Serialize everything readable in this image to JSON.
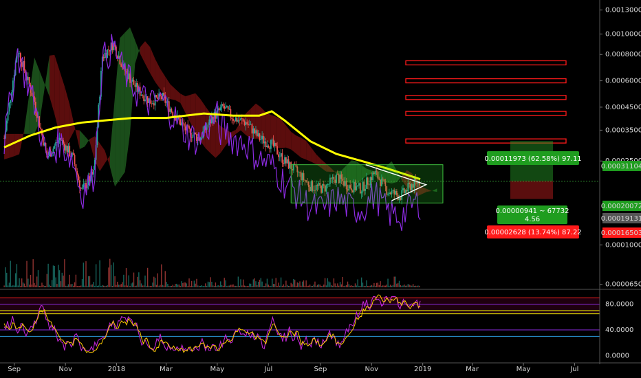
{
  "chart_data": {
    "type": "candlestick",
    "price_axis": {
      "scale": "log",
      "ticks": [
        "0.00130000",
        "0.00100000",
        "0.00080000",
        "0.00060000",
        "0.00045000",
        "0.00035000",
        "0.00025000",
        "0.00010000",
        "0.00006500"
      ],
      "tick_values": [
        0.0013,
        0.001,
        0.0008,
        0.0006,
        0.00045,
        0.00035,
        0.00025,
        0.0001,
        6.5e-05
      ],
      "range": [
        6.2e-05,
        0.00145
      ]
    },
    "time_axis": {
      "labels": [
        "Sep",
        "Nov",
        "2018",
        "Mar",
        "May",
        "Jul",
        "Sep",
        "Nov",
        "2019",
        "Mar",
        "May",
        "Jul"
      ]
    },
    "price_series": [
      [
        "2017-08-20",
        0.00032
      ],
      [
        "2017-09-05",
        0.00085
      ],
      [
        "2017-09-25",
        0.00048
      ],
      [
        "2017-10-10",
        0.00026
      ],
      [
        "2017-10-25",
        0.00032
      ],
      [
        "2017-11-10",
        0.00026
      ],
      [
        "2017-11-20",
        0.00018
      ],
      [
        "2017-12-05",
        0.00022
      ],
      [
        "2017-12-15",
        0.00078
      ],
      [
        "2017-12-28",
        0.0009
      ],
      [
        "2018-01-10",
        0.00068
      ],
      [
        "2018-01-25",
        0.00055
      ],
      [
        "2018-02-10",
        0.00048
      ],
      [
        "2018-02-25",
        0.0005
      ],
      [
        "2018-03-10",
        0.00042
      ],
      [
        "2018-03-25",
        0.00035
      ],
      [
        "2018-04-10",
        0.00032
      ],
      [
        "2018-04-25",
        0.0004
      ],
      [
        "2018-05-08",
        0.00045
      ],
      [
        "2018-05-20",
        0.0004
      ],
      [
        "2018-06-05",
        0.00038
      ],
      [
        "2018-06-20",
        0.00032
      ],
      [
        "2018-07-05",
        0.0003
      ],
      [
        "2018-07-20",
        0.00025
      ],
      [
        "2018-08-05",
        0.00022
      ],
      [
        "2018-08-20",
        0.00019
      ],
      [
        "2018-09-05",
        0.000185
      ],
      [
        "2018-09-20",
        0.00021
      ],
      [
        "2018-10-05",
        0.00019
      ],
      [
        "2018-10-20",
        0.000185
      ],
      [
        "2018-11-05",
        0.00022
      ],
      [
        "2018-11-20",
        0.00018
      ],
      [
        "2018-12-05",
        0.00017
      ],
      [
        "2018-12-20",
        0.000195
      ],
      [
        "2018-12-29",
        0.0002007
      ]
    ],
    "moving_average": [
      [
        "2017-08-20",
        0.00029
      ],
      [
        "2017-09-20",
        0.00033
      ],
      [
        "2017-10-20",
        0.00036
      ],
      [
        "2017-11-20",
        0.00038
      ],
      [
        "2017-12-20",
        0.00039
      ],
      [
        "2018-01-20",
        0.0004
      ],
      [
        "2018-03-01",
        0.0004
      ],
      [
        "2018-04-15",
        0.00042
      ],
      [
        "2018-05-20",
        0.00041
      ],
      [
        "2018-06-20",
        0.00041
      ],
      [
        "2018-07-05",
        0.00043
      ],
      [
        "2018-07-20",
        0.00039
      ],
      [
        "2018-08-20",
        0.00031
      ],
      [
        "2018-09-20",
        0.00027
      ],
      [
        "2018-10-20",
        0.00025
      ],
      [
        "2018-11-20",
        0.00023
      ],
      [
        "2018-12-29",
        0.000205
      ]
    ],
    "resistance_levels": [
      0.00073,
      0.0006,
      0.0005,
      0.00042,
      0.00031104
    ],
    "labels": {
      "target": "0.00011973 (62.58%) 97.11",
      "target_level": "0.00031104",
      "current": "0.00020072",
      "position_line1": "0.00000941 ~ 67732",
      "position_line2": "4.56",
      "entry_level": "0.00019131",
      "stop": "0.00002628 (13.74%) 87.22",
      "stop_level": "0.00016503"
    },
    "oscillator": {
      "ticks": [
        "80.0000",
        "40.0000",
        "0.0000"
      ],
      "tick_values": [
        80,
        40,
        0
      ],
      "levels": [
        90,
        80,
        70,
        65,
        40,
        30
      ]
    }
  },
  "colors": {
    "background": "#000000",
    "candle_up": "#26a69a",
    "candle_down": "#ef5350",
    "moving_average": "#ffff00",
    "secondary_line": "#8c2be2",
    "cloud_bear": "#6b0f0f",
    "cloud_bull": "#1f5a1f",
    "resistance": "#ff1a1a",
    "target_box": "#1f7a1f",
    "stop_box": "#ff0000"
  }
}
